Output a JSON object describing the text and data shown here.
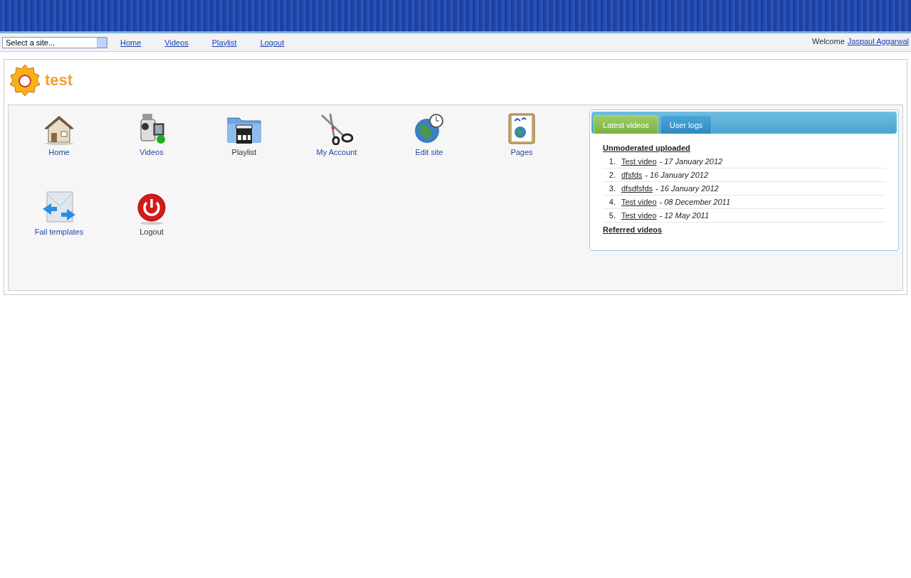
{
  "site_select": {
    "value": "Select a site..."
  },
  "nav": [
    {
      "label": "Home"
    },
    {
      "label": "Videos"
    },
    {
      "label": "Playlist"
    },
    {
      "label": "Logout"
    }
  ],
  "welcome": {
    "text": "Welcome",
    "user": "Jaspaul Aggarwal"
  },
  "site": {
    "title": "test"
  },
  "shortcuts": [
    {
      "label": "Home",
      "kind": "house",
      "visited": false
    },
    {
      "label": "Videos",
      "kind": "camera",
      "visited": false
    },
    {
      "label": "Playlist",
      "kind": "folder",
      "visited": true
    },
    {
      "label": "My Account",
      "kind": "scissors",
      "visited": false
    },
    {
      "label": "Edit site",
      "kind": "globe",
      "visited": false
    },
    {
      "label": "Pages",
      "kind": "document",
      "visited": false
    },
    {
      "label": "Fail templates",
      "kind": "envelope",
      "visited": false
    },
    {
      "label": "Logout",
      "kind": "power",
      "visited": true
    }
  ],
  "widget": {
    "tabs": [
      {
        "label": "Latest videos",
        "selected": true
      },
      {
        "label": "User logs",
        "selected": false
      }
    ],
    "heading": "Unmoderated uploaded",
    "videos": [
      {
        "number": "1.",
        "title": "Test video",
        "date": "- 17 January 2012"
      },
      {
        "number": "2.",
        "title": "dfsfds",
        "date": "- 16 January 2012"
      },
      {
        "number": "3.",
        "title": "dfsdfsfds",
        "date": "- 16 January 2012"
      },
      {
        "number": "4.",
        "title": "Test video",
        "date": "- 08 December 2011"
      },
      {
        "number": "5.",
        "title": "Test video",
        "date": "- 12 May 2011"
      }
    ],
    "footer_link": "Referred videos"
  }
}
